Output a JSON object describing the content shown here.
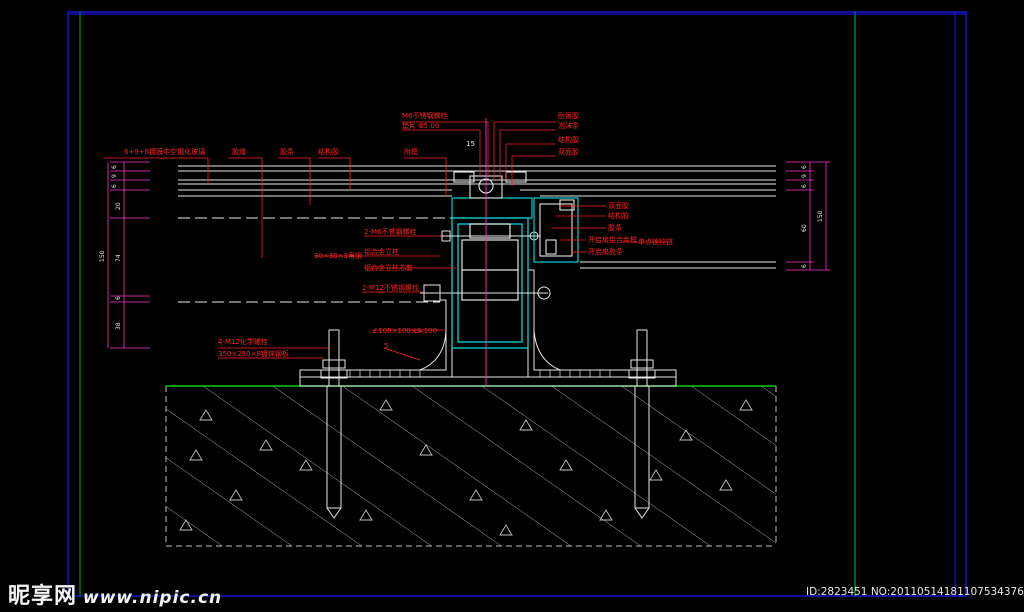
{
  "colors": {
    "background": "#000000",
    "border_blue": "#1a1aff",
    "border_green": "#00cc44",
    "line_white": "#e6e6e6",
    "cyan": "#00e5e5",
    "label_red": "#ff2020",
    "dim_magenta": "#ff33cc",
    "ground_green": "#00cc00",
    "hatch": "#bfbfbf"
  },
  "labels_left": {
    "glass_spec": "6+9+6镀膜中空钢化玻璃",
    "l2": "胶缝",
    "l3": "胶条",
    "l4": "结构胶",
    "l5": "附框",
    "m6": "2-M6不锈钢螺栓",
    "alu_col": "铝合金立柱",
    "steel_tube": "30×30×3角钢",
    "insert": "铝合金立柱芯套",
    "m12": "2-M12不锈钢螺栓",
    "angle": "∠100×100×8",
    "angle_len": "L=100",
    "chem_bolt": "4-M12化学螺栓",
    "plate": "350×250×8镀锌钢板",
    "weld": "5"
  },
  "labels_top": {
    "m6_bolt": "M6不锈钢螺栓",
    "gasket": "垫片 Φ5.00",
    "sealant": "耐候胶",
    "foam": "泡沫条",
    "t3": "结构胶",
    "t4": "双面胶",
    "dim5": "15"
  },
  "labels_right": {
    "r1": "双面胶",
    "r2": "结构胶",
    "r3": "胶条",
    "r4": "开启扇铝合金框",
    "r5": "开启扇胶条",
    "r6": "单点锁铰链"
  },
  "dims_left": [
    "6",
    "9",
    "6",
    "20",
    "74",
    "6",
    "38",
    "150"
  ],
  "dims_right": [
    "6",
    "9",
    "6",
    "60",
    "6",
    "150"
  ],
  "watermark": {
    "brand": "昵享网",
    "url": "www.nipic.cn",
    "id": "ID:2823451 NO:20110514181107534376"
  }
}
